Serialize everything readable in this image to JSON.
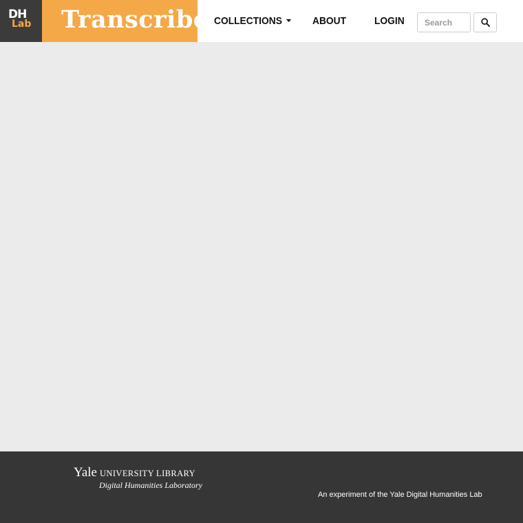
{
  "colors": {
    "brand_orange": "#f5a847",
    "dh_background": "#3b3b3b",
    "footer_background": "#363636",
    "content_background": "#ebebeb"
  },
  "header": {
    "dh_logo": {
      "line1": "DH",
      "line2": "Lab"
    },
    "brand": "Transcribe",
    "nav": {
      "collections": "COLLECTIONS",
      "about": "ABOUT",
      "login": "LOGIN"
    },
    "search": {
      "placeholder": "Search",
      "icon": "search-icon"
    }
  },
  "footer": {
    "yale": "Yale",
    "university_library": "UNIVERSITY LIBRARY",
    "dhl": "Digital Humanities Laboratory",
    "experiment": "An experiment of the Yale Digital Humanities Lab"
  }
}
